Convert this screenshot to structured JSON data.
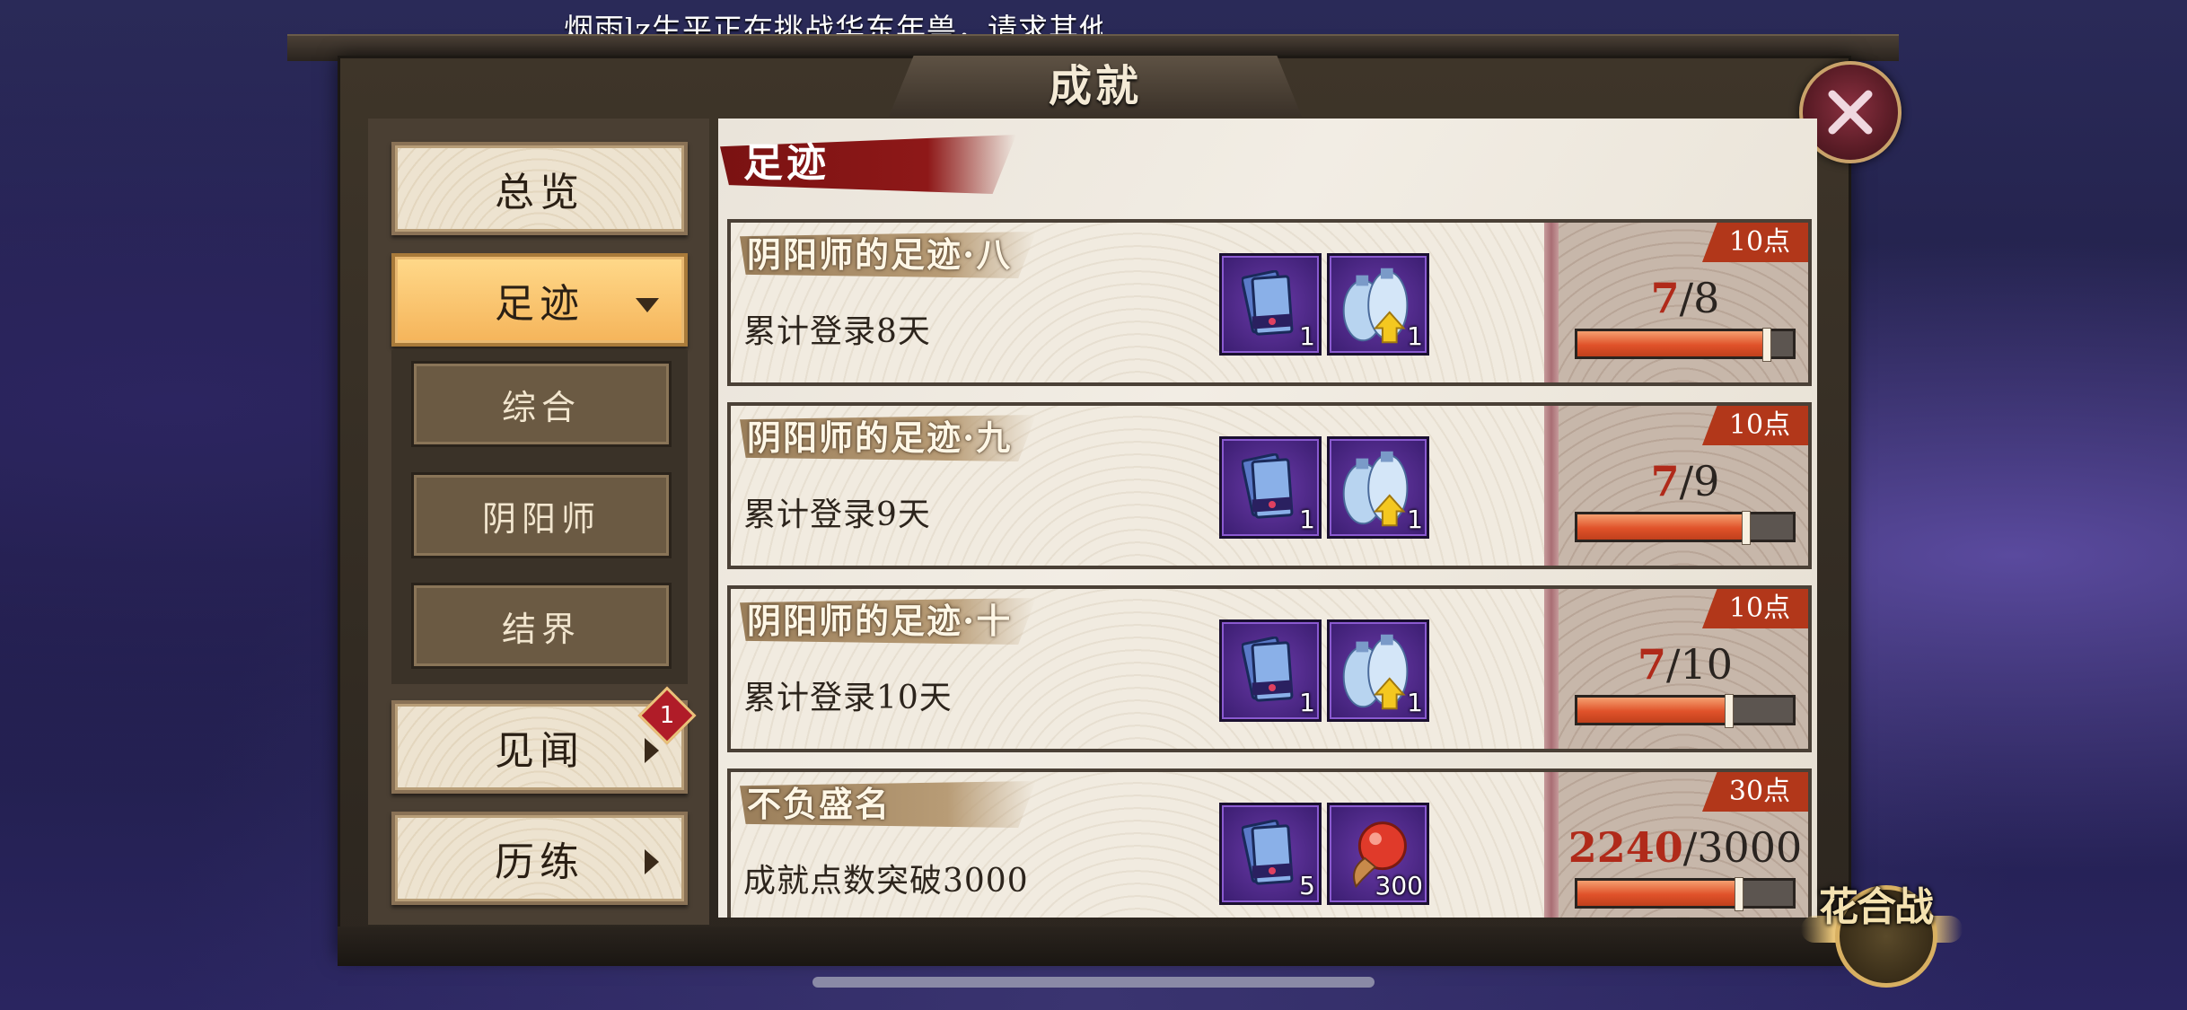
{
  "ticker": "烟雨lz生平正在挑战华东年兽，请求其他",
  "window_title": "成就",
  "sidebar": {
    "overview": "总览",
    "footprint": "足迹",
    "sub_items": [
      "综合",
      "阴阳师",
      "结界"
    ],
    "jianwen": "见闻",
    "jianwen_badge": "1",
    "lilian": "历练"
  },
  "section_title": "足迹",
  "achievements": [
    {
      "title": "阴阳师的足迹·八",
      "desc": "累计登录8天",
      "rewards": [
        {
          "icon": "ticket-icon",
          "qty": "1"
        },
        {
          "icon": "sake-bag-upgrade-icon",
          "qty": "1"
        }
      ],
      "points": "10点",
      "current": "7",
      "total": "/8",
      "progress": 0.875
    },
    {
      "title": "阴阳师的足迹·九",
      "desc": "累计登录9天",
      "rewards": [
        {
          "icon": "ticket-icon",
          "qty": "1"
        },
        {
          "icon": "sake-bag-upgrade-icon",
          "qty": "1"
        }
      ],
      "points": "10点",
      "current": "7",
      "total": "/9",
      "progress": 0.778
    },
    {
      "title": "阴阳师的足迹·十",
      "desc": "累计登录10天",
      "rewards": [
        {
          "icon": "ticket-icon",
          "qty": "1"
        },
        {
          "icon": "sake-bag-upgrade-icon",
          "qty": "1"
        }
      ],
      "points": "10点",
      "current": "7",
      "total": "/10",
      "progress": 0.7
    },
    {
      "title": "不负盛名",
      "desc": "成就点数突破3000",
      "rewards": [
        {
          "icon": "ticket-icon",
          "qty": "5"
        },
        {
          "icon": "red-magatama-icon",
          "qty": "300"
        }
      ],
      "points": "30点",
      "current": "2240",
      "total": "/3000",
      "progress": 0.747
    }
  ],
  "corner_logo": "花合战",
  "colors": {
    "accent_red": "#b02a1a",
    "active_tab": "#f5b45a",
    "reward_bg": "#3a1d70"
  }
}
